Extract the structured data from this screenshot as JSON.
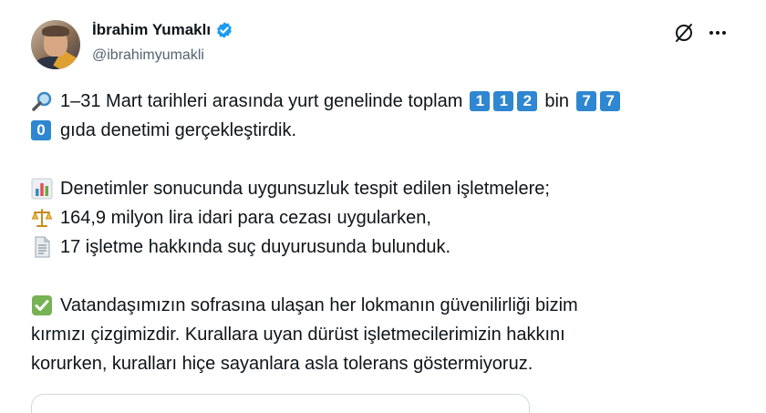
{
  "author": {
    "display_name": "İbrahim Yumaklı",
    "handle": "@ibrahimyumakli",
    "verified": true
  },
  "icons": {
    "verified": "verified-badge-icon",
    "grok": "grok-icon",
    "more": "more-options-icon",
    "magnifier": "magnifying-glass-icon",
    "chart": "bar-chart-icon",
    "scales": "balance-scale-icon",
    "document": "document-icon",
    "check": "check-mark-button-icon"
  },
  "colors": {
    "text": "#0f1419",
    "secondary": "#536471",
    "verified_blue": "#1d9bf0",
    "keycap_blue": "#2f86d1",
    "check_green": "#77b255"
  },
  "tweet": {
    "line1_text": "1–31 Mart tarihleri arasında yurt genelinde toplam",
    "keycaps_a": [
      "1",
      "1",
      "2"
    ],
    "word_bin": "bin",
    "keycaps_b": [
      "7",
      "7"
    ],
    "keycap_c": "0",
    "line2_text": "gıda denetimi gerçekleştirdik.",
    "line3_text": "Denetimler sonucunda uygunsuzluk tespit edilen işletmelere;",
    "line4_text": "164,9 milyon lira idari para cezası uygularken,",
    "line5_text": "17 işletme hakkında suç duyurusunda bulunduk.",
    "line6_text": "Vatandaşımızın sofrasına ulaşan her lokmanın güvenilirliği bizim",
    "line7_text": "kırmızı çizgimizdir. Kurallara uyan dürüst işletmecilerimizin hakkını",
    "line8_text": "korurken, kuralları hiçe sayanlara asla tolerans göstermiyoruz."
  }
}
